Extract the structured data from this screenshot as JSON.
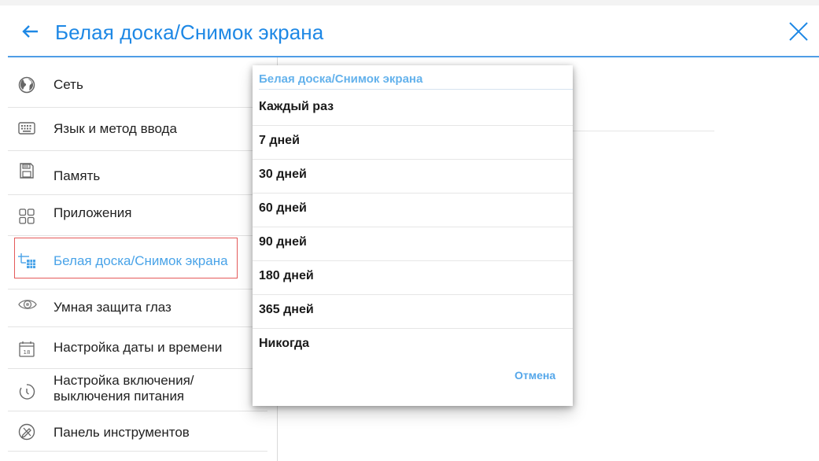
{
  "header": {
    "title": "Белая доска/Снимок экрана"
  },
  "sidebar": {
    "items": [
      {
        "label": "Сеть",
        "icon": "globe-icon"
      },
      {
        "label": "Язык и метод ввода",
        "icon": "keyboard-icon"
      },
      {
        "label": "Память",
        "icon": "storage-icon"
      },
      {
        "label": "Приложения",
        "icon": "apps-grid-icon"
      },
      {
        "label": "Белая доска/Снимок экрана",
        "icon": "whiteboard-screenshot-icon",
        "active": true
      },
      {
        "label": "Умная защита глаз",
        "icon": "eye-icon"
      },
      {
        "label": "Настройка даты и времени",
        "icon": "calendar-icon",
        "icon_text": "18"
      },
      {
        "label": "Настройка включения/\nвыключения питания",
        "line1": "Настройка включения/",
        "line2": "выключения питания",
        "icon": "power-timer-icon"
      },
      {
        "label": "Панель инструментов",
        "icon": "toolbar-icon"
      }
    ]
  },
  "dialog": {
    "title": "Белая доска/Снимок экрана",
    "options": [
      "Каждый раз",
      "7 дней",
      "30 дней",
      "60 дней",
      "90 дней",
      "180 дней",
      "365 дней",
      "Никогда"
    ],
    "cancel_label": "Отмена"
  },
  "colors": {
    "accent": "#1e88e5",
    "highlight_border": "#e45a5a",
    "dialog_title": "#64b2ec"
  }
}
